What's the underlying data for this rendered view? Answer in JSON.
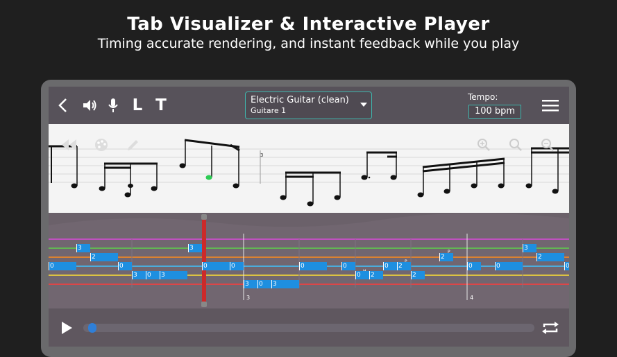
{
  "promo": {
    "title": "Tab Visualizer & Interactive Player",
    "subtitle": "Timing accurate rendering, and instant feedback while you play"
  },
  "toolbar": {
    "lyrics_toggle_label": "L",
    "text_toggle_label": "T",
    "instrument": {
      "name": "Electric Guitar (clean)",
      "track": "Guitare 1"
    },
    "tempo": {
      "label": "Tempo:",
      "value": "100 bpm"
    }
  },
  "notation": {
    "tuplet_label": "3"
  },
  "tab": {
    "measure_numbers": [
      "3",
      "4"
    ],
    "technique_labels": [
      "H",
      "P",
      "P"
    ],
    "notes": [
      {
        "fret": "3"
      },
      {
        "fret": "2"
      },
      {
        "fret": "0"
      },
      {
        "fret": "0"
      },
      {
        "fret": "3"
      },
      {
        "fret": "0"
      },
      {
        "fret": "3"
      },
      {
        "fret": "3"
      },
      {
        "fret": "0"
      },
      {
        "fret": "0"
      },
      {
        "fret": "3"
      },
      {
        "fret": "0"
      },
      {
        "fret": "3"
      },
      {
        "fret": "0"
      },
      {
        "fret": "0"
      },
      {
        "fret": "0"
      },
      {
        "fret": "2"
      },
      {
        "fret": "0"
      },
      {
        "fret": "2"
      },
      {
        "fret": "2"
      },
      {
        "fret": "2"
      },
      {
        "fret": "0"
      },
      {
        "fret": "0"
      },
      {
        "fret": "3"
      },
      {
        "fret": "2"
      },
      {
        "fret": "0"
      }
    ]
  },
  "player": {
    "progress": 0.01
  },
  "colors": {
    "accent": "#3fb7ae",
    "note_block": "#1e8fe0",
    "strings": [
      "#d94ad9",
      "#5fd14a",
      "#ff8c1a",
      "#3fc4ff",
      "#ffe033",
      "#ff3b3b"
    ]
  }
}
